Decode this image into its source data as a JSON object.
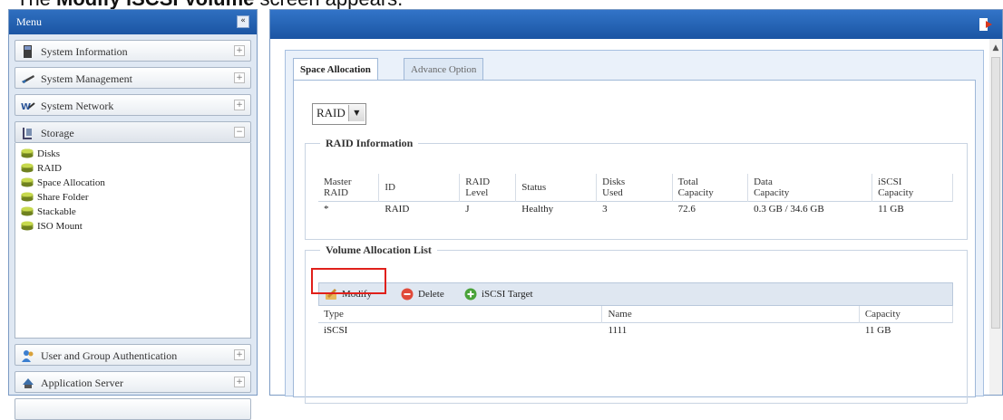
{
  "caption": {
    "prefix": "The ",
    "bold": "Modify iSCSI Volume",
    "suffix": " screen appears."
  },
  "menu": {
    "title": "Menu",
    "collapse": "«",
    "sections": [
      {
        "label": "System Information",
        "icon": "monitor-icon"
      },
      {
        "label": "System Management",
        "icon": "tools-icon"
      },
      {
        "label": "System Network",
        "icon": "network-icon"
      },
      {
        "label": "Storage",
        "icon": "storage-icon"
      }
    ],
    "storage_items": [
      "Disks",
      "RAID",
      "Space Allocation",
      "Share Folder",
      "Stackable",
      "ISO Mount"
    ],
    "bottom_sections": [
      {
        "label": "User and Group Authentication",
        "icon": "users-icon"
      },
      {
        "label": "Application Server",
        "icon": "server-icon"
      }
    ]
  },
  "tabs": [
    "Space Allocation",
    "Advance Option"
  ],
  "raid_select": "RAID",
  "raid_info": {
    "legend": "RAID Information",
    "headers": [
      [
        "Master",
        "RAID"
      ],
      [
        "ID"
      ],
      [
        "RAID",
        "Level"
      ],
      [
        "Status"
      ],
      [
        "Disks",
        "Used"
      ],
      [
        "Total",
        "Capacity"
      ],
      [
        "Data",
        "Capacity"
      ],
      [
        "iSCSI",
        "Capacity"
      ]
    ],
    "row": [
      "*",
      "RAID",
      "J",
      "Healthy",
      "3",
      "72.6",
      "0.3 GB / 34.6 GB",
      "11 GB"
    ]
  },
  "volume": {
    "legend": "Volume Allocation List",
    "toolbar": {
      "modify": "Modify",
      "delete": "Delete",
      "iscsi": "iSCSI Target"
    },
    "headers": [
      "Type",
      "Name",
      "Capacity"
    ],
    "row": [
      "iSCSI",
      "1111",
      "11 GB"
    ]
  },
  "colors": {
    "accent": "#1b55a3",
    "highlight": "#e0201b"
  }
}
